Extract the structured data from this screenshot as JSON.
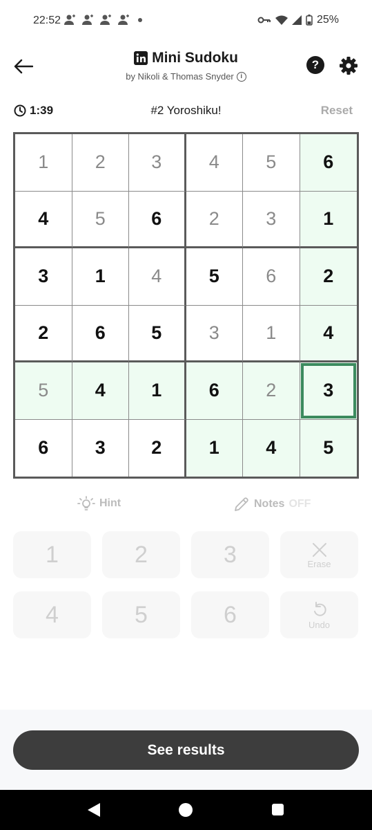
{
  "status_bar": {
    "time": "22:52",
    "battery": "25%",
    "icons": [
      "person-icon",
      "person-icon",
      "person-icon",
      "person-icon",
      "dot-icon",
      "vpn-key-icon",
      "wifi-icon",
      "signal-icon",
      "battery-icon"
    ]
  },
  "header": {
    "title": "Mini Sudoku",
    "subtitle": "by Nikoli & Thomas Snyder",
    "info_glyph": "i",
    "help_glyph": "?"
  },
  "game": {
    "timer": "1:39",
    "puzzle_name": "#2 Yoroshiku!",
    "reset_label": "Reset"
  },
  "board": {
    "size": 6,
    "selected": [
      4,
      5
    ],
    "rows": [
      [
        {
          "v": "1",
          "t": "filled"
        },
        {
          "v": "2",
          "t": "filled"
        },
        {
          "v": "3",
          "t": "filled"
        },
        {
          "v": "4",
          "t": "filled"
        },
        {
          "v": "5",
          "t": "filled"
        },
        {
          "v": "6",
          "t": "given"
        }
      ],
      [
        {
          "v": "4",
          "t": "given"
        },
        {
          "v": "5",
          "t": "filled"
        },
        {
          "v": "6",
          "t": "given"
        },
        {
          "v": "2",
          "t": "filled"
        },
        {
          "v": "3",
          "t": "filled"
        },
        {
          "v": "1",
          "t": "given"
        }
      ],
      [
        {
          "v": "3",
          "t": "given"
        },
        {
          "v": "1",
          "t": "given"
        },
        {
          "v": "4",
          "t": "filled"
        },
        {
          "v": "5",
          "t": "given"
        },
        {
          "v": "6",
          "t": "filled"
        },
        {
          "v": "2",
          "t": "given"
        }
      ],
      [
        {
          "v": "2",
          "t": "given"
        },
        {
          "v": "6",
          "t": "given"
        },
        {
          "v": "5",
          "t": "given"
        },
        {
          "v": "3",
          "t": "filled"
        },
        {
          "v": "1",
          "t": "filled"
        },
        {
          "v": "4",
          "t": "given"
        }
      ],
      [
        {
          "v": "5",
          "t": "filled"
        },
        {
          "v": "4",
          "t": "given"
        },
        {
          "v": "1",
          "t": "given"
        },
        {
          "v": "6",
          "t": "given"
        },
        {
          "v": "2",
          "t": "filled"
        },
        {
          "v": "3",
          "t": "given"
        }
      ],
      [
        {
          "v": "6",
          "t": "given"
        },
        {
          "v": "3",
          "t": "given"
        },
        {
          "v": "2",
          "t": "given"
        },
        {
          "v": "1",
          "t": "given"
        },
        {
          "v": "4",
          "t": "given"
        },
        {
          "v": "5",
          "t": "given"
        }
      ]
    ]
  },
  "tools": {
    "hint_label": "Hint",
    "notes_label": "Notes",
    "notes_state": "OFF"
  },
  "keypad": {
    "digits": [
      "1",
      "2",
      "3",
      "4",
      "5",
      "6"
    ],
    "erase_label": "Erase",
    "undo_label": "Undo"
  },
  "footer": {
    "results_label": "See results"
  },
  "colors": {
    "highlight": "#eefcf2",
    "selected_border": "#3b8a5e",
    "button_dark": "#3d3d3d"
  }
}
